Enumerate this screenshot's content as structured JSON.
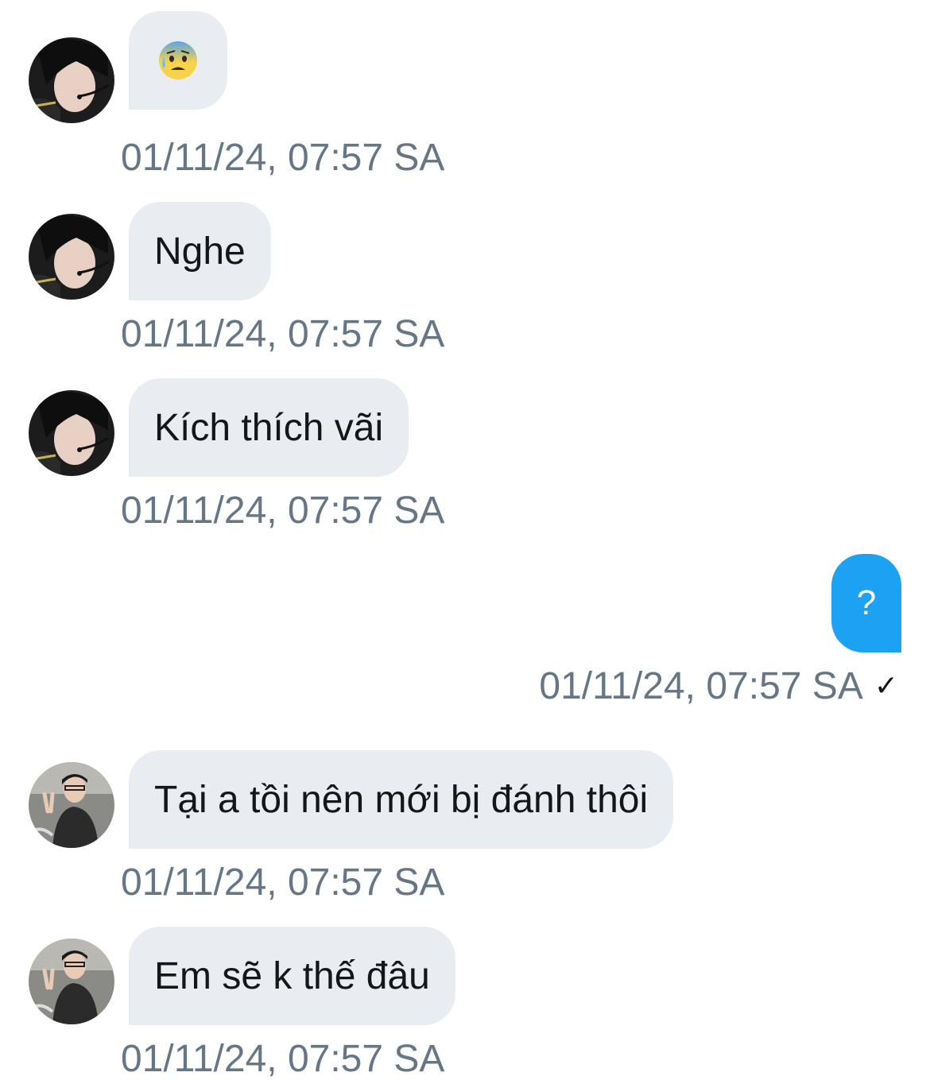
{
  "messages": [
    {
      "sender": "them",
      "avatar": "avatar-dark-hair-headset",
      "emoji": "anxious-face-with-sweat",
      "text": "",
      "time": "01/11/24, 07:57 SA"
    },
    {
      "sender": "them",
      "avatar": "avatar-dark-hair-headset",
      "text": "Nghe",
      "time": "01/11/24, 07:57 SA"
    },
    {
      "sender": "them",
      "avatar": "avatar-dark-hair-headset",
      "text": "Kích thích vãi",
      "time": "01/11/24, 07:57 SA"
    },
    {
      "sender": "me",
      "text": "?",
      "time": "01/11/24, 07:57 SA",
      "status": "✓"
    },
    {
      "sender": "them",
      "avatar": "avatar-peace-sign",
      "text": "Tại a tồi nên mới bị đánh thôi",
      "time": "01/11/24, 07:57 SA"
    },
    {
      "sender": "them",
      "avatar": "avatar-peace-sign",
      "text": "Em sẽ k thế đâu",
      "time": "01/11/24, 07:57 SA"
    }
  ],
  "colors": {
    "incoming_bubble": "#e9edf1",
    "outgoing_bubble": "#1da1f2",
    "timestamp": "#657786",
    "text": "#14171a"
  }
}
